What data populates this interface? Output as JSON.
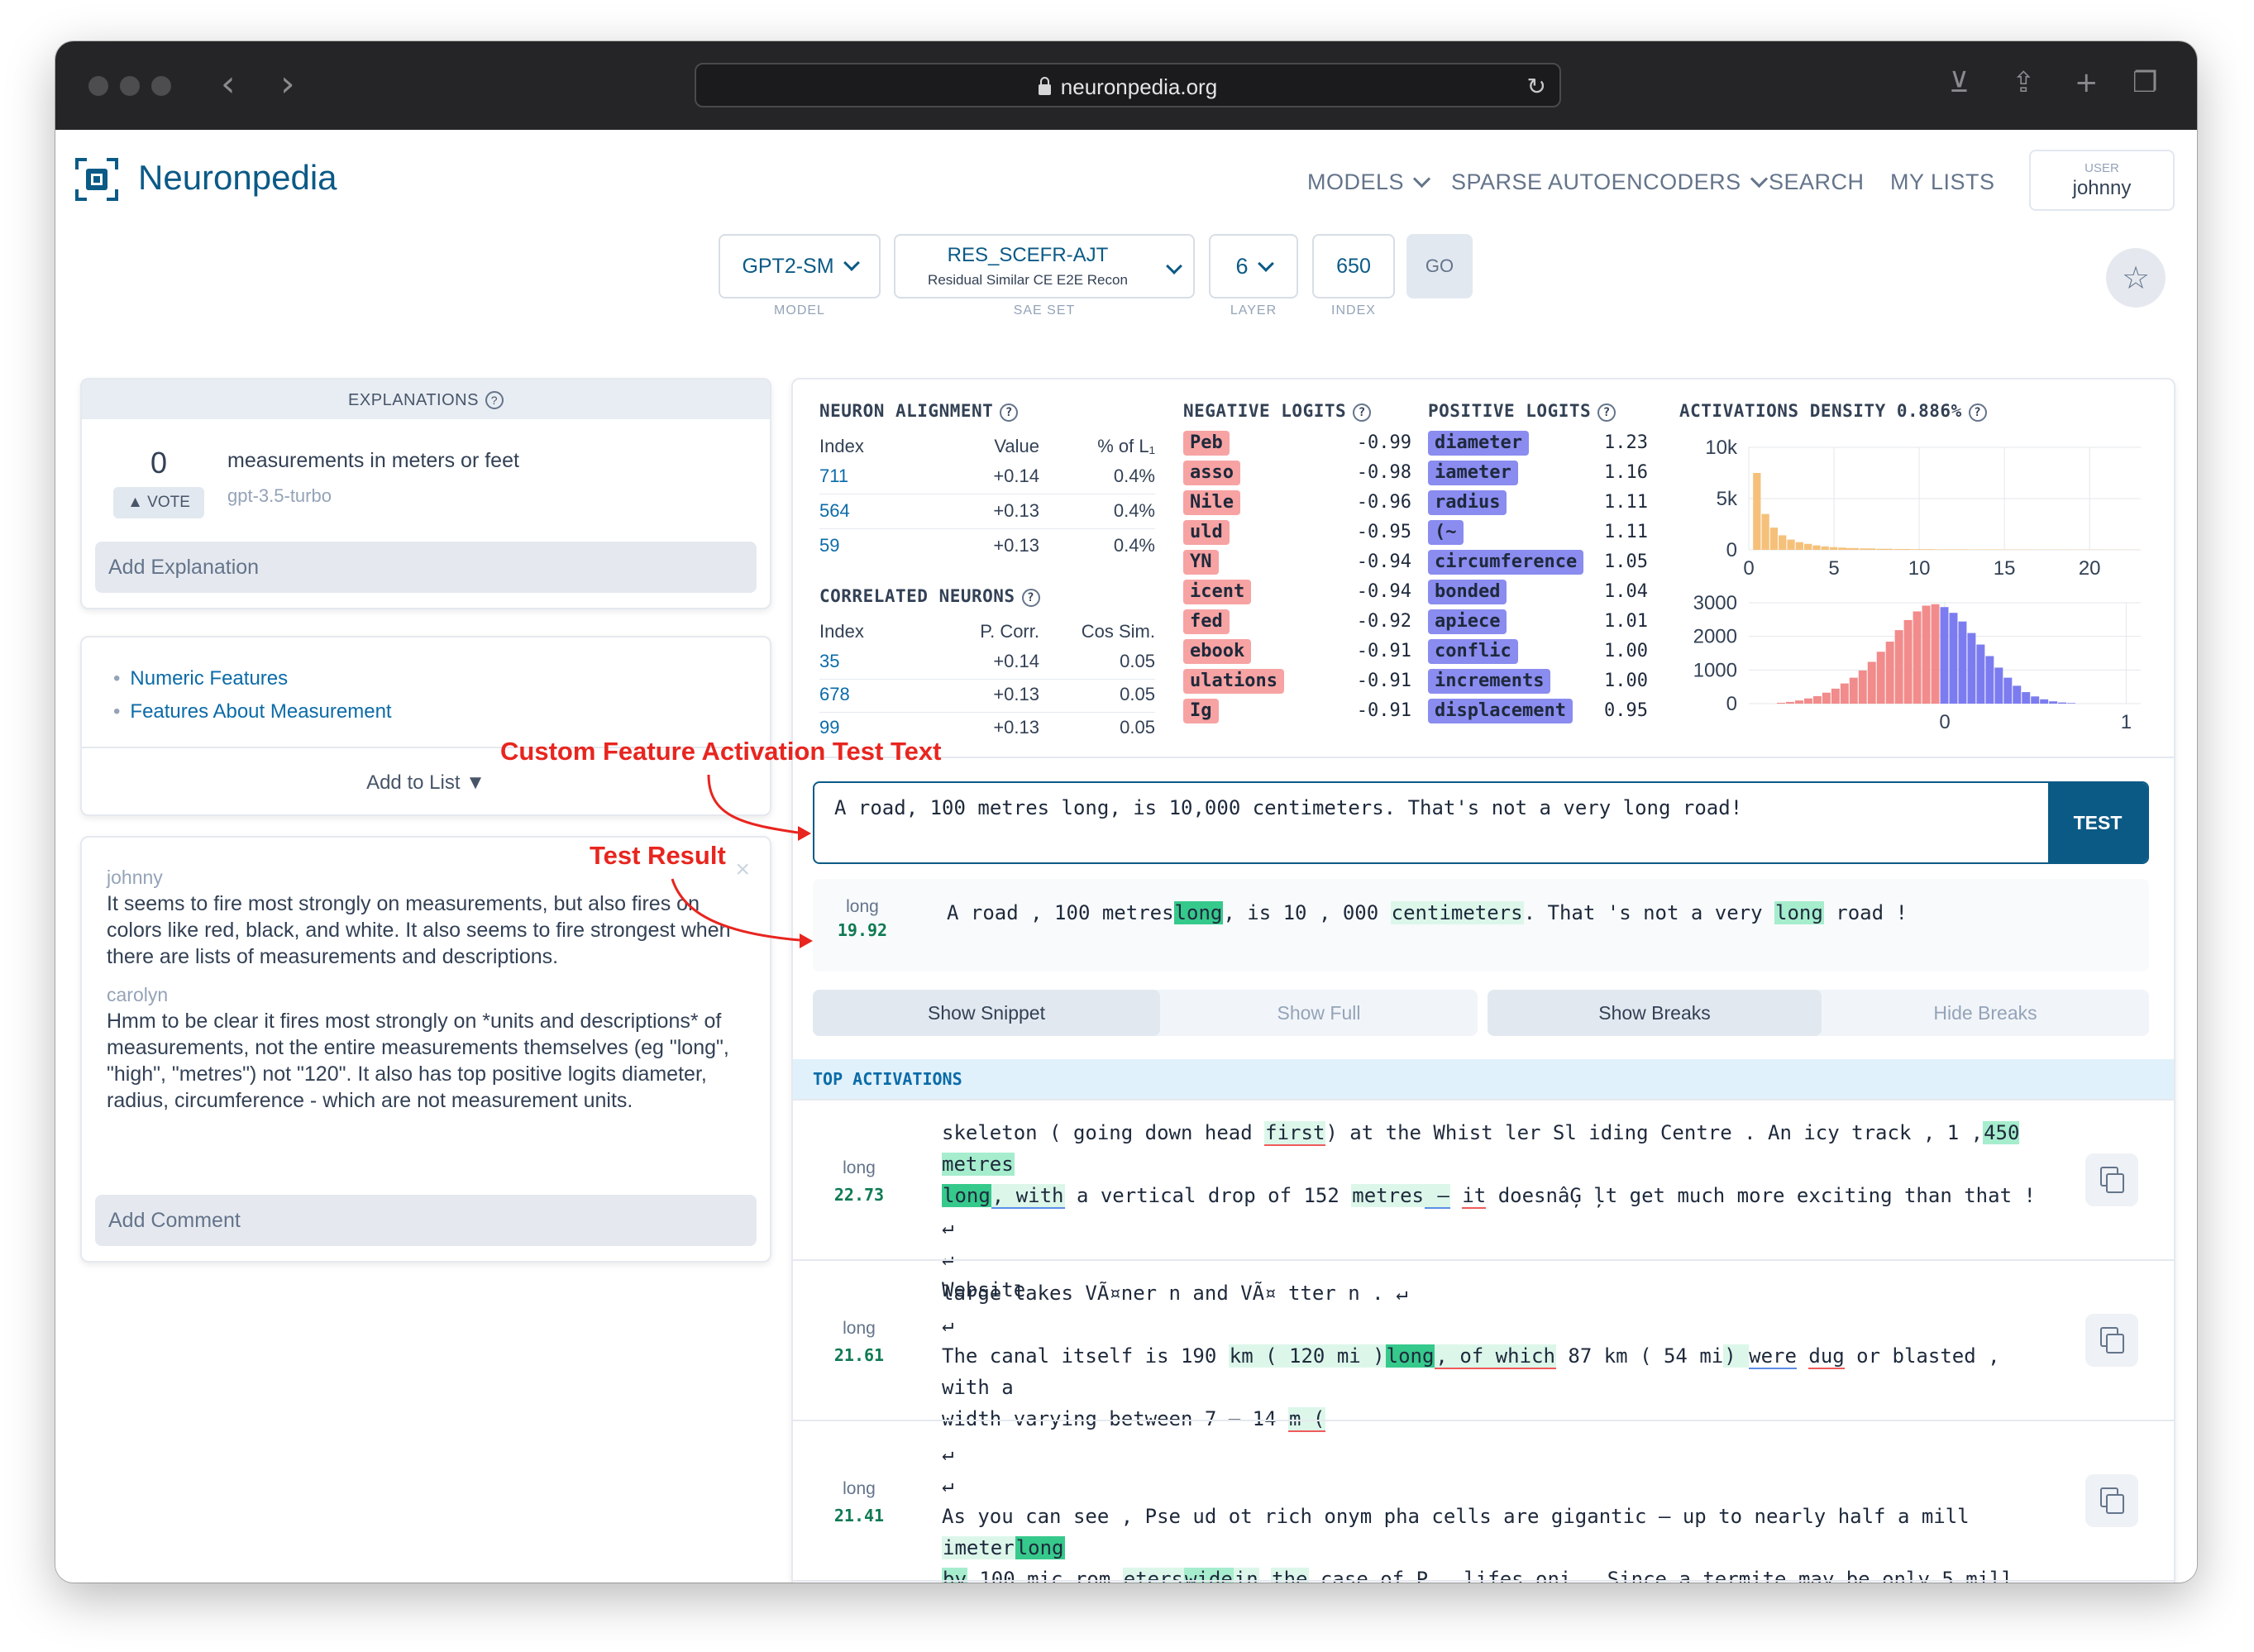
{
  "browser": {
    "url": "neuronpedia.org"
  },
  "header": {
    "brand": "Neuronpedia",
    "nav": [
      "MODELS",
      "SPARSE AUTOENCODERS",
      "SEARCH",
      "MY LISTS"
    ],
    "user_label": "USER",
    "username": "johnny"
  },
  "selectors": {
    "model": {
      "value": "GPT2-SM",
      "caption": "MODEL"
    },
    "sae_set": {
      "value": "RES_SCEFR-AJT",
      "sub": "Residual Similar CE E2E Recon",
      "caption": "SAE SET"
    },
    "layer": {
      "value": "6",
      "caption": "LAYER"
    },
    "index": {
      "value": "650",
      "caption": "INDEX"
    },
    "go": "GO"
  },
  "explanations": {
    "title": "EXPLANATIONS",
    "votes": "0",
    "vote_label": "▲ VOTE",
    "text": "measurements in meters or feet",
    "model": "gpt-3.5-turbo",
    "add_placeholder": "Add Explanation"
  },
  "lists": {
    "items": [
      "Numeric Features",
      "Features About Measurement"
    ],
    "add_label": "Add to List ▼"
  },
  "comments": {
    "items": [
      {
        "author": "johnny",
        "text": "It seems to fire most strongly on measurements, but also fires on colors like red, black, and white. It also seems to fire strongest when there are lists of measurements and descriptions."
      },
      {
        "author": "carolyn",
        "text": "Hmm to be clear it fires most strongly on *units and descriptions* of measurements, not the entire measurements themselves (eg \"long\", \"high\", \"metres\") not \"120\". It also has top positive logits diameter, radius, circumference - which are not measurement units."
      }
    ],
    "close": "×",
    "add_placeholder": "Add Comment"
  },
  "neuron_alignment": {
    "title": "NEURON ALIGNMENT",
    "headers": [
      "Index",
      "Value",
      "% of L₁"
    ],
    "rows": [
      [
        "711",
        "+0.14",
        "0.4%"
      ],
      [
        "564",
        "+0.13",
        "0.4%"
      ],
      [
        "59",
        "+0.13",
        "0.4%"
      ]
    ]
  },
  "correlated_neurons": {
    "title": "CORRELATED NEURONS",
    "headers": [
      "Index",
      "P. Corr.",
      "Cos Sim."
    ],
    "rows": [
      [
        "35",
        "+0.14",
        "0.05"
      ],
      [
        "678",
        "+0.13",
        "0.05"
      ],
      [
        "99",
        "+0.13",
        "0.05"
      ]
    ]
  },
  "negative_logits": {
    "title": "NEGATIVE LOGITS",
    "color": "#f7a3a3",
    "items": [
      [
        "Peb",
        "-0.99"
      ],
      [
        "asso",
        "-0.98"
      ],
      [
        "Nile",
        "-0.96"
      ],
      [
        "uld",
        "-0.95"
      ],
      [
        "YN",
        "-0.94"
      ],
      [
        "icent",
        "-0.94"
      ],
      [
        "fed",
        "-0.92"
      ],
      [
        "ebook",
        "-0.91"
      ],
      [
        "ulations",
        "-0.91"
      ],
      [
        "Ig",
        "-0.91"
      ]
    ]
  },
  "positive_logits": {
    "title": "POSITIVE LOGITS",
    "color": "#8a8cf0",
    "items": [
      [
        "diameter",
        "1.23"
      ],
      [
        "iameter",
        "1.16"
      ],
      [
        "radius",
        "1.11"
      ],
      [
        "(~",
        "1.11"
      ],
      [
        "circumference",
        "1.05"
      ],
      [
        "bonded",
        "1.04"
      ],
      [
        "apiece",
        "1.01"
      ],
      [
        "conflic",
        "1.00"
      ],
      [
        "increments",
        "1.00"
      ],
      [
        "displacement",
        "0.95"
      ]
    ]
  },
  "density": {
    "title": "ACTIVATIONS DENSITY 0.886%"
  },
  "chart_data": [
    {
      "type": "bar",
      "title": "ACTIVATIONS DENSITY 0.886%",
      "color": "#f5c17a",
      "xlim": [
        0,
        23
      ],
      "ylim": [
        0,
        12000
      ],
      "xticks": [
        "0",
        "5",
        "10",
        "15",
        "20"
      ],
      "yticks": [
        "10k",
        "5k",
        "0"
      ],
      "x": [
        0.5,
        1,
        1.5,
        2,
        2.5,
        3,
        3.5,
        4,
        4.5,
        5,
        5.5,
        6,
        7,
        8,
        9,
        10,
        12,
        14,
        16,
        18,
        20,
        22
      ],
      "values": [
        9000,
        4200,
        2600,
        1700,
        1200,
        900,
        700,
        520,
        400,
        320,
        260,
        210,
        160,
        120,
        90,
        70,
        50,
        40,
        30,
        25,
        20,
        15
      ]
    },
    {
      "type": "bar",
      "color_negative": "#f28b8b",
      "color_positive": "#7c7cf0",
      "xlim": [
        -1.08,
        1.08
      ],
      "ylim": [
        0,
        3500
      ],
      "xticks": [
        "0",
        "1"
      ],
      "yticks": [
        "3000",
        "2000",
        "1000",
        "0"
      ],
      "x": [
        -0.9,
        -0.85,
        -0.8,
        -0.75,
        -0.7,
        -0.65,
        -0.6,
        -0.55,
        -0.5,
        -0.45,
        -0.4,
        -0.35,
        -0.3,
        -0.25,
        -0.2,
        -0.15,
        -0.1,
        -0.05,
        0.0,
        0.05,
        0.1,
        0.15,
        0.2,
        0.25,
        0.3,
        0.35,
        0.4,
        0.45,
        0.5,
        0.55,
        0.6,
        0.65,
        0.7
      ],
      "values": [
        30,
        60,
        110,
        180,
        260,
        380,
        520,
        700,
        900,
        1150,
        1450,
        1800,
        2150,
        2550,
        2900,
        3200,
        3400,
        3450,
        3350,
        3150,
        2850,
        2450,
        2050,
        1650,
        1250,
        900,
        620,
        400,
        250,
        150,
        80,
        40,
        20
      ]
    }
  ],
  "annotations": {
    "custom_text": "Custom Feature Activation Test Text",
    "test_result": "Test Result"
  },
  "test": {
    "input": "A road, 100 metres long, is 10,000 centimeters. That's not a very long road!",
    "button": "TEST",
    "result_word": "long",
    "result_value": "19.92"
  },
  "toggles": {
    "snippet": "Show Snippet",
    "full": "Show Full",
    "breaks": "Show Breaks",
    "hide_breaks": "Hide Breaks"
  },
  "top_activations": {
    "title": "TOP ACTIVATIONS",
    "items": [
      {
        "word": "long",
        "value": "22.73"
      },
      {
        "word": "long",
        "value": "21.61"
      },
      {
        "word": "long",
        "value": "21.41"
      }
    ]
  }
}
